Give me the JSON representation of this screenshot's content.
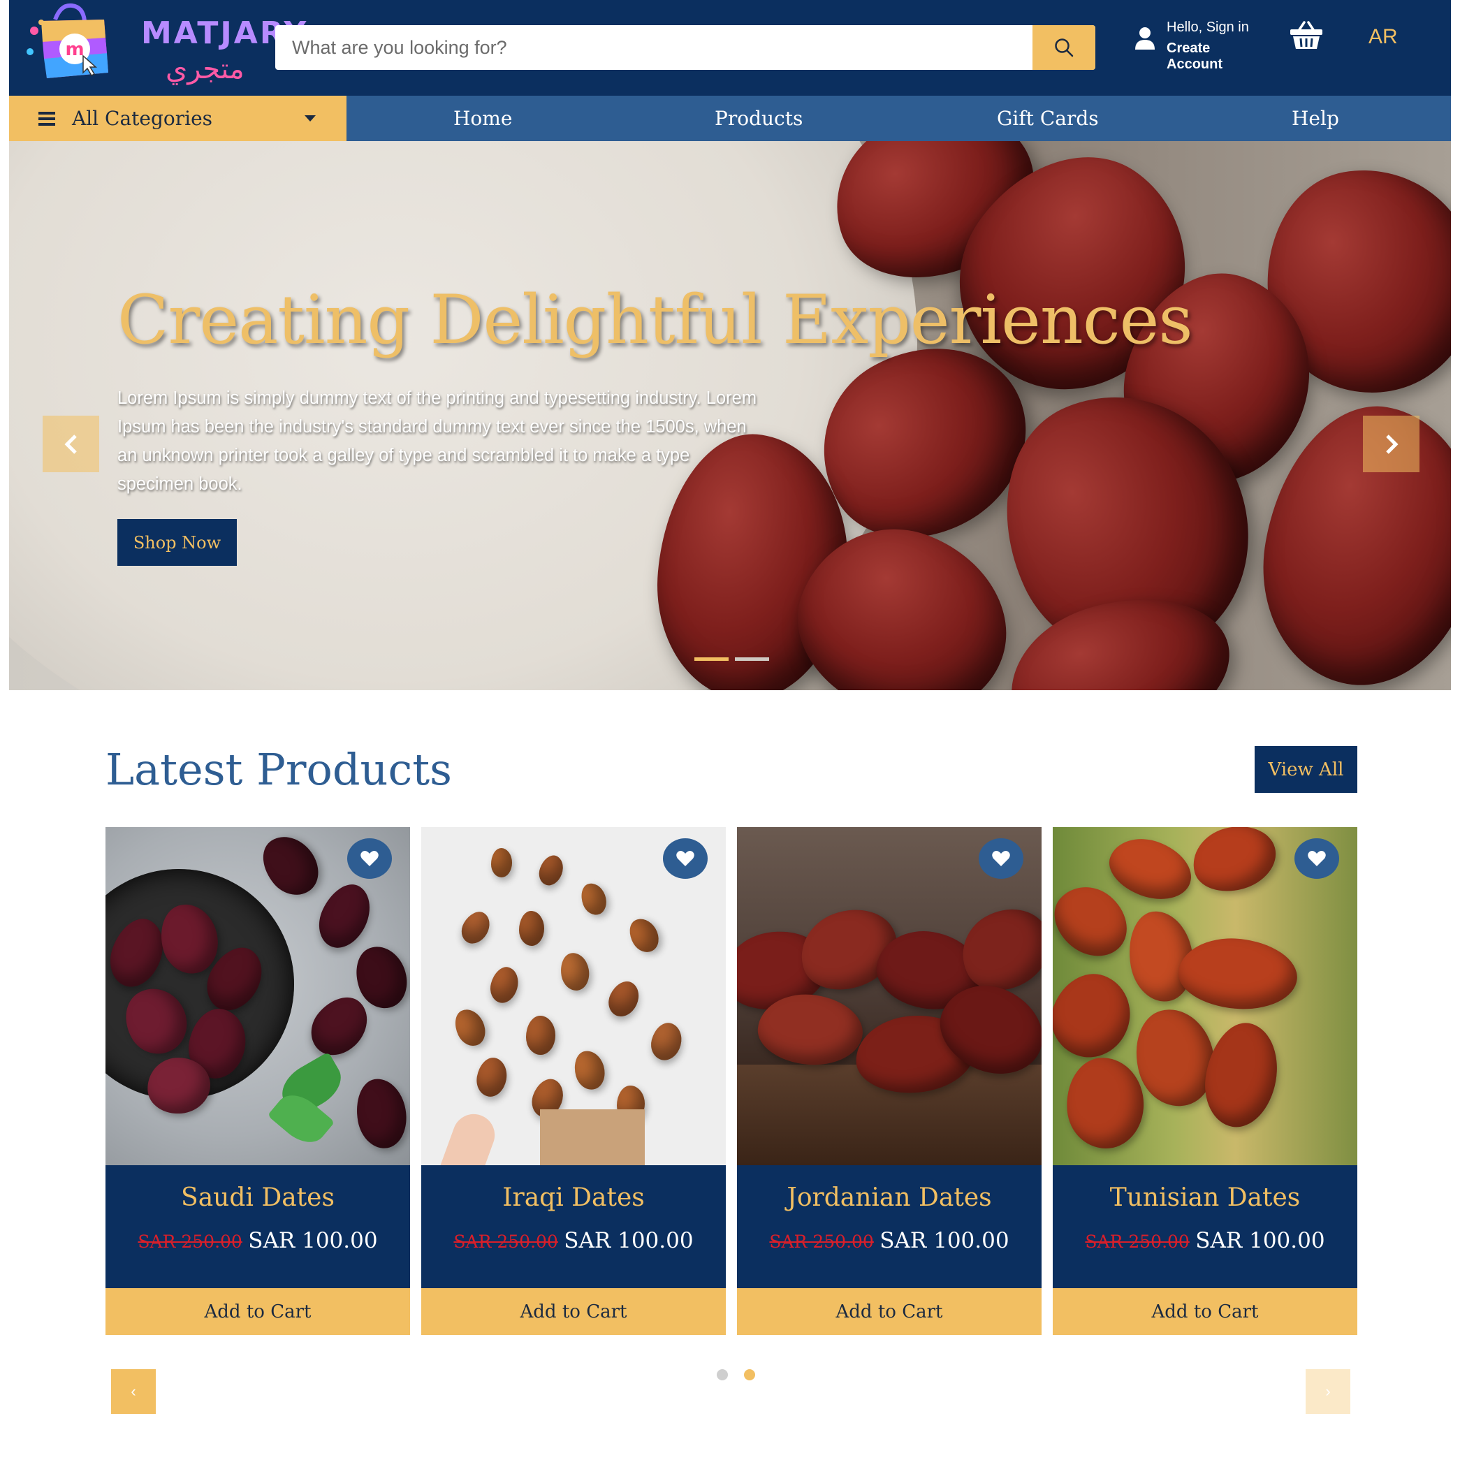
{
  "header": {
    "logo_text": "MATJARY",
    "logo_arabic": "متجري",
    "search_placeholder": "What are you looking for?",
    "account_hello": "Hello, Sign in",
    "account_create": "Create Account",
    "language": "AR"
  },
  "nav": {
    "all_categories": "All Categories",
    "links": [
      "Home",
      "Products",
      "Gift Cards",
      "Help"
    ]
  },
  "hero": {
    "title": "Creating Delightful Experiences",
    "text": "Lorem Ipsum is simply dummy text of the printing and typesetting industry. Lorem Ipsum has been the industry's standard dummy text ever since the 1500s, when an unknown printer took a galley of type and scrambled it to make a type specimen book.",
    "button": "Shop Now",
    "active_slide": 1,
    "slide_count": 2
  },
  "latest": {
    "title": "Latest Products",
    "view_all": "View All",
    "products": [
      {
        "name": "Saudi Dates",
        "old_price": "SAR 250.00",
        "price": "SAR 100.00",
        "cart": "Add to Cart"
      },
      {
        "name": "Iraqi Dates",
        "old_price": "SAR 250.00",
        "price": "SAR 100.00",
        "cart": "Add to Cart"
      },
      {
        "name": "Jordanian Dates",
        "old_price": "SAR 250.00",
        "price": "SAR 100.00",
        "cart": "Add to Cart"
      },
      {
        "name": "Tunisian Dates",
        "old_price": "SAR 250.00",
        "price": "SAR 100.00",
        "cart": "Add to Cart"
      }
    ],
    "prev_label": "‹",
    "next_label": "›",
    "active_page": 2,
    "page_count": 2
  },
  "colors": {
    "navy": "#0b2f5f",
    "nav_blue": "#2e5d92",
    "gold": "#f2bf62",
    "sale_red": "#d81f2a"
  },
  "icons": [
    "search-icon",
    "user-icon",
    "basket-icon",
    "menu-icon",
    "caret-down-icon",
    "chevron-left-icon",
    "chevron-right-icon",
    "heart-icon"
  ]
}
